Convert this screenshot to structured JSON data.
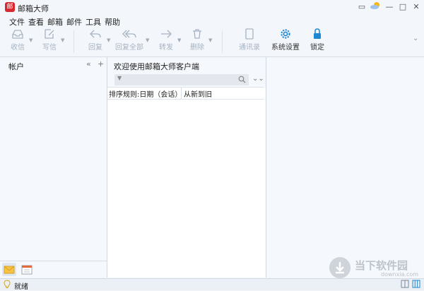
{
  "window": {
    "logo_char": "邮",
    "title": "邮箱大师",
    "controls": {
      "message": "▭",
      "minimize": "—",
      "maximize": "□",
      "close": "✕"
    }
  },
  "menu": [
    "文件",
    "查看",
    "邮箱",
    "邮件",
    "工具",
    "帮助"
  ],
  "toolbar": {
    "receive": "收信",
    "compose": "写信",
    "reply": "回复",
    "reply_all": "回复全部",
    "forward": "转发",
    "delete": "删除",
    "contacts": "通讯录",
    "settings": "系统设置",
    "lock": "锁定",
    "overflow": "⌄"
  },
  "left_panel": {
    "title": "帐户",
    "collapse": "«",
    "add": "+"
  },
  "middle_panel": {
    "welcome": "欢迎使用邮箱大师客户端",
    "sort_label": "排序规则:日期（会话）",
    "sort_order": "从新到旧",
    "expand": "⌄⌄"
  },
  "watermark": {
    "text": "当下软件园",
    "sub": "downxia.com"
  },
  "status": {
    "text": "就绪"
  },
  "colors": {
    "accent": "#1e88d2",
    "brand": "#d9272e",
    "disabled": "#a7b3c2"
  }
}
